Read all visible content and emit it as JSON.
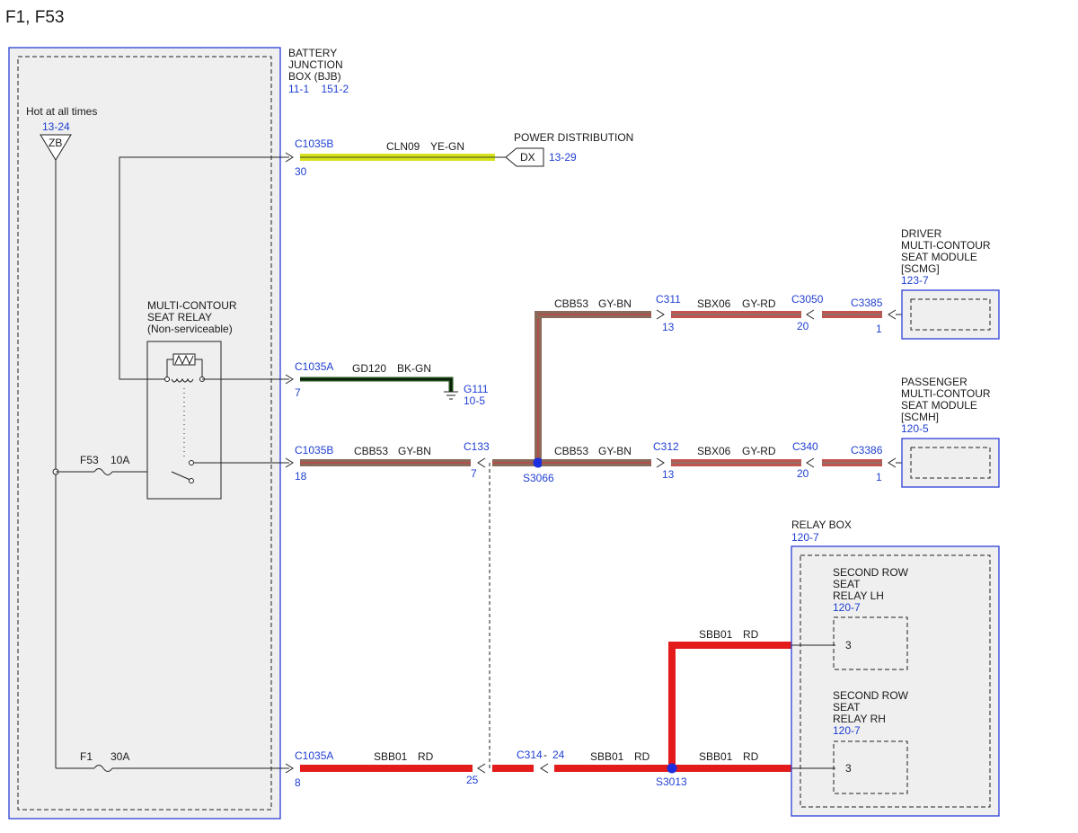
{
  "page_title": "F1, F53",
  "colors": {
    "module_outline": "#2b3fd6",
    "ref_text": "#1f3fd1",
    "wire_red": "#e31b1b",
    "wire_gy_bn": "#8a6a5a",
    "wire_gy_rd": "#c0554f",
    "wire_ye_gn": "#d8e21c",
    "wire_bk_gn": "#1f4f1a",
    "splice": "#1b2fe0"
  },
  "bjb": {
    "lines": [
      "BATTERY",
      "JUNCTION",
      "BOX (BJB)"
    ],
    "refs": "11-1    151-2"
  },
  "hot": {
    "label": "Hot at all times",
    "ref": "13-24",
    "symbol": "ZB"
  },
  "relay": {
    "lines": [
      "MULTI-CONTOUR",
      "SEAT RELAY",
      "(Non-serviceable)"
    ]
  },
  "fuses": {
    "f53": {
      "name": "F53",
      "rating": "10A"
    },
    "f1": {
      "name": "F1",
      "rating": "30A"
    }
  },
  "power_dist": {
    "label": "POWER DISTRIBUTION",
    "symbol": "DX",
    "ref": "13-29",
    "connector": "C1035B",
    "pin": "30",
    "circuit": "CLN09",
    "color": "YE-GN"
  },
  "ground": {
    "connector": "C1035A",
    "pin": "7",
    "circuit": "GD120",
    "color": "BK-GN",
    "name": "G111",
    "ref": "10-5"
  },
  "seat_feed": {
    "connector": "C1035B",
    "pin": "18",
    "circuit": "CBB53",
    "color": "GY-BN",
    "inline": "C133",
    "inline_pin": "7",
    "splice": "S3066"
  },
  "driver": {
    "circuit": "CBB53",
    "color": "GY-BN",
    "c1": "C311",
    "c1_pin": "13",
    "circuit2": "SBX06",
    "color2": "GY-RD",
    "c2": "C3050",
    "c2_pin": "20",
    "c3": "C3385",
    "c3_pin": "1",
    "module_lines": [
      "DRIVER",
      "MULTI-CONTOUR",
      "SEAT MODULE",
      "[SCMG]"
    ],
    "module_ref": "123-7"
  },
  "passenger": {
    "circuit": "CBB53",
    "color": "GY-BN",
    "c1": "C312",
    "c1_pin": "13",
    "circuit2": "SBX06",
    "color2": "GY-RD",
    "c2": "C340",
    "c2_pin": "20",
    "c3": "C3386",
    "c3_pin": "1",
    "module_lines": [
      "PASSENGER",
      "MULTI-CONTOUR",
      "SEAT MODULE",
      "[SCMH]"
    ],
    "module_ref": "120-5"
  },
  "relay_feed": {
    "connector": "C1035A",
    "pin": "8",
    "circuit": "SBB01",
    "color": "RD",
    "inline_pin_left": "25",
    "inline": "C314",
    "inline_sep": "-",
    "inline_pin_right": "24",
    "splice": "S3013"
  },
  "relay_box": {
    "label": "RELAY BOX",
    "ref": "120-7",
    "lh": {
      "lines": [
        "SECOND ROW",
        "SEAT",
        "RELAY LH"
      ],
      "ref": "120-7",
      "pin": "3",
      "circuit": "SBB01",
      "color": "RD"
    },
    "rh": {
      "lines": [
        "SECOND ROW",
        "SEAT",
        "RELAY RH"
      ],
      "ref": "120-7",
      "pin": "3",
      "circuit": "SBB01",
      "color": "RD"
    }
  }
}
